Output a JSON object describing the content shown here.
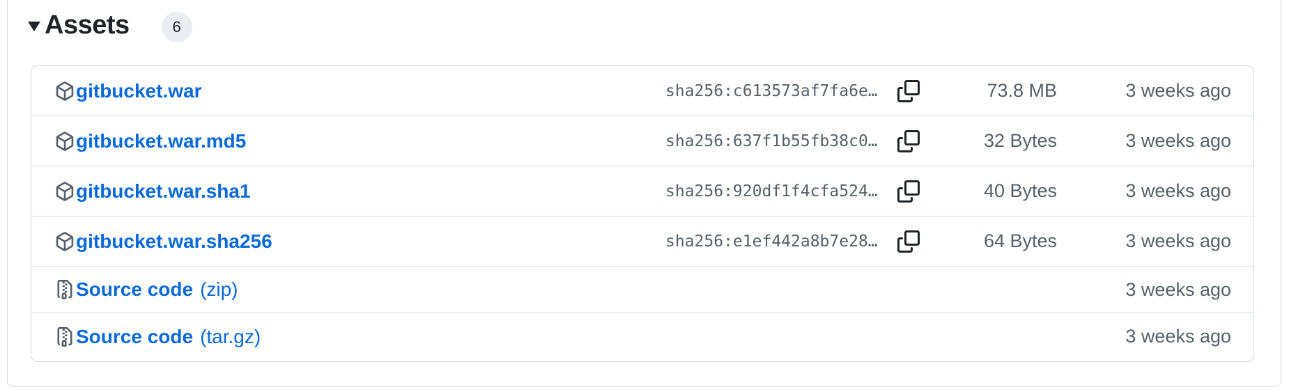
{
  "assets": {
    "title": "Assets",
    "count": "6",
    "rows": [
      {
        "icon": "package-icon",
        "name": "gitbucket.war",
        "suffix": "",
        "sha": "sha256:c613573af7fa6e…",
        "size": "73.8 MB",
        "date": "3 weeks ago"
      },
      {
        "icon": "package-icon",
        "name": "gitbucket.war.md5",
        "suffix": "",
        "sha": "sha256:637f1b55fb38c0…",
        "size": "32 Bytes",
        "date": "3 weeks ago"
      },
      {
        "icon": "package-icon",
        "name": "gitbucket.war.sha1",
        "suffix": "",
        "sha": "sha256:920df1f4cfa524…",
        "size": "40 Bytes",
        "date": "3 weeks ago"
      },
      {
        "icon": "package-icon",
        "name": "gitbucket.war.sha256",
        "suffix": "",
        "sha": "sha256:e1ef442a8b7e28…",
        "size": "64 Bytes",
        "date": "3 weeks ago"
      },
      {
        "icon": "file-zip-icon",
        "name": "Source code",
        "suffix": "(zip)",
        "sha": "",
        "size": "",
        "date": "3 weeks ago"
      },
      {
        "icon": "file-zip-icon",
        "name": "Source code",
        "suffix": "(tar.gz)",
        "sha": "",
        "size": "",
        "date": "3 weeks ago"
      }
    ]
  },
  "colors": {
    "link": "#0969da",
    "muted": "#57606a",
    "border": "#d0d7de",
    "badge_bg": "#eaeef2"
  }
}
